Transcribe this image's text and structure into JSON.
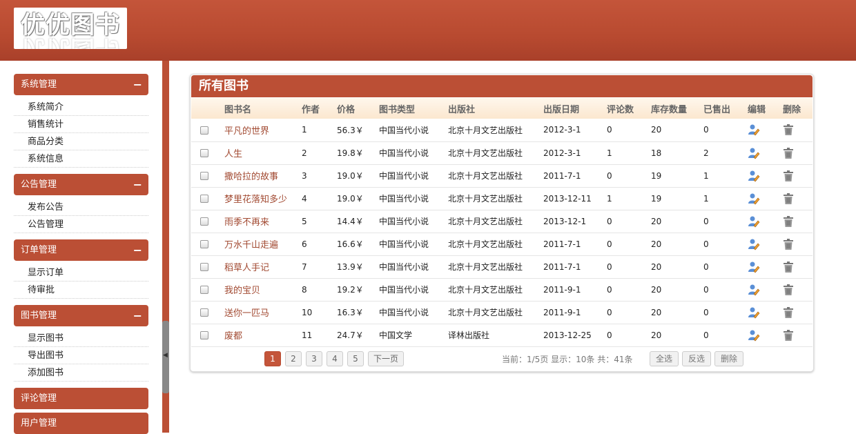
{
  "logo": {
    "text": "优优图书"
  },
  "sidebar": {
    "groups": [
      {
        "title": "系统管理",
        "toggle": "−",
        "items": [
          "系统简介",
          "销售统计",
          "商品分类",
          "系统信息"
        ]
      },
      {
        "title": "公告管理",
        "toggle": "−",
        "items": [
          "发布公告",
          "公告管理"
        ]
      },
      {
        "title": "订单管理",
        "toggle": "−",
        "items": [
          "显示订单",
          "待审批"
        ]
      },
      {
        "title": "图书管理",
        "toggle": "−",
        "items": [
          "显示图书",
          "导出图书",
          "添加图书"
        ]
      },
      {
        "title": "评论管理"
      },
      {
        "title": "用户管理"
      }
    ]
  },
  "panel": {
    "title": "所有图书",
    "columns": [
      "图书名",
      "作者",
      "价格",
      "图书类型",
      "出版社",
      "出版日期",
      "评论数",
      "库存数量",
      "已售出",
      "编辑",
      "删除"
    ],
    "rows": [
      {
        "name": "平凡的世界",
        "author": "1",
        "price": "56.3￥",
        "type": "中国当代小说",
        "publisher": "北京十月文艺出版社",
        "date": "2012-3-1",
        "comments": "0",
        "stock": "20",
        "sold": "0"
      },
      {
        "name": "人生",
        "author": "2",
        "price": "19.8￥",
        "type": "中国当代小说",
        "publisher": "北京十月文艺出版社",
        "date": "2012-3-1",
        "comments": "1",
        "stock": "18",
        "sold": "2"
      },
      {
        "name": "撒哈拉的故事",
        "author": "3",
        "price": "19.0￥",
        "type": "中国当代小说",
        "publisher": "北京十月文艺出版社",
        "date": "2011-7-1",
        "comments": "0",
        "stock": "19",
        "sold": "1"
      },
      {
        "name": "梦里花落知多少",
        "author": "4",
        "price": "19.0￥",
        "type": "中国当代小说",
        "publisher": "北京十月文艺出版社",
        "date": "2013-12-11",
        "comments": "1",
        "stock": "19",
        "sold": "1"
      },
      {
        "name": "雨季不再来",
        "author": "5",
        "price": "14.4￥",
        "type": "中国当代小说",
        "publisher": "北京十月文艺出版社",
        "date": "2013-12-1",
        "comments": "0",
        "stock": "20",
        "sold": "0"
      },
      {
        "name": "万水千山走遍",
        "author": "6",
        "price": "16.6￥",
        "type": "中国当代小说",
        "publisher": "北京十月文艺出版社",
        "date": "2011-7-1",
        "comments": "0",
        "stock": "20",
        "sold": "0"
      },
      {
        "name": "稻草人手记",
        "author": "7",
        "price": "13.9￥",
        "type": "中国当代小说",
        "publisher": "北京十月文艺出版社",
        "date": "2011-7-1",
        "comments": "0",
        "stock": "20",
        "sold": "0"
      },
      {
        "name": "我的宝贝",
        "author": "8",
        "price": "19.2￥",
        "type": "中国当代小说",
        "publisher": "北京十月文艺出版社",
        "date": "2011-9-1",
        "comments": "0",
        "stock": "20",
        "sold": "0"
      },
      {
        "name": "送你一匹马",
        "author": "10",
        "price": "16.3￥",
        "type": "中国当代小说",
        "publisher": "北京十月文艺出版社",
        "date": "2011-9-1",
        "comments": "0",
        "stock": "20",
        "sold": "0"
      },
      {
        "name": "废都",
        "author": "11",
        "price": "24.7￥",
        "type": "中国文学",
        "publisher": "译林出版社",
        "date": "2013-12-25",
        "comments": "0",
        "stock": "20",
        "sold": "0"
      }
    ],
    "edit_icon": "edit-user-icon",
    "delete_icon": "trash-icon"
  },
  "pager": {
    "pages": [
      "1",
      "2",
      "3",
      "4",
      "5"
    ],
    "active_page": "1",
    "next_label": "下一页",
    "info": "当前：1/5页  显示：10条  共：41条",
    "select_all": "全选",
    "invert": "反选",
    "delete": "删除"
  },
  "colors": {
    "brand": "#bb4f35",
    "link": "#a24a32"
  }
}
